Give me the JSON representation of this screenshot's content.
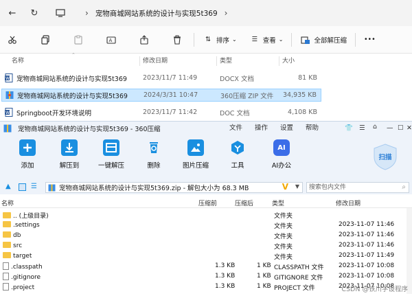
{
  "explorer": {
    "breadcrumb": [
      "宠物商城网站系统的设计与实现5t369"
    ],
    "commands": {
      "sort": "排序",
      "view": "查看",
      "extract_all": "全部解压缩",
      "more": "•••"
    },
    "columns": [
      "名称",
      "修改日期",
      "类型",
      "大小"
    ],
    "files": [
      {
        "name": "宠物商城网站系统的设计与实现5t369",
        "date": "2023/11/7 11:49",
        "type": "DOCX 文档",
        "size": "81 KB",
        "icon": "word-icon",
        "selected": false
      },
      {
        "name": "宠物商城网站系统的设计与实现5t369",
        "date": "2024/3/31 10:47",
        "type": "360压缩 ZIP 文件",
        "size": "34,935 KB",
        "icon": "zip-icon",
        "selected": true
      },
      {
        "name": "Springboot开发环境说明",
        "date": "2023/11/7 11:42",
        "type": "DOC 文档",
        "size": "4,108 KB",
        "icon": "word-icon",
        "selected": false
      }
    ]
  },
  "zip_window": {
    "title": "宠物商城网站系统的设计与实现5t369 - 360压缩",
    "menu": [
      "文件",
      "操作",
      "设置",
      "帮助"
    ],
    "tools": [
      "添加",
      "解压到",
      "一键解压",
      "删除",
      "图片压缩",
      "工具",
      "AI办公"
    ],
    "scan_label": "扫描",
    "path_text": "宠物商城网站系统的设计与实现5t369.zip - 解包大小为 68.3 MB",
    "search_placeholder": "搜索包内文件",
    "columns": [
      "名称",
      "压缩前",
      "压缩后",
      "类型",
      "修改日期"
    ],
    "rows": [
      {
        "name": ".. (上级目录)",
        "before": "",
        "after": "",
        "type": "文件夹",
        "date": "",
        "kind": "folder"
      },
      {
        "name": ".settings",
        "before": "",
        "after": "",
        "type": "文件夹",
        "date": "2023-11-07 11:46",
        "kind": "folder"
      },
      {
        "name": "db",
        "before": "",
        "after": "",
        "type": "文件夹",
        "date": "2023-11-07 11:46",
        "kind": "folder"
      },
      {
        "name": "src",
        "before": "",
        "after": "",
        "type": "文件夹",
        "date": "2023-11-07 11:46",
        "kind": "folder"
      },
      {
        "name": "target",
        "before": "",
        "after": "",
        "type": "文件夹",
        "date": "2023-11-07 11:49",
        "kind": "folder"
      },
      {
        "name": ".classpath",
        "before": "1.3 KB",
        "after": "1 KB",
        "type": "CLASSPATH 文件",
        "date": "2023-11-07 10:08",
        "kind": "file"
      },
      {
        "name": ".gitignore",
        "before": "1.3 KB",
        "after": "1 KB",
        "type": "GITIGNORE 文件",
        "date": "2023-11-07 10:08",
        "kind": "file"
      },
      {
        "name": ".project",
        "before": "1.3 KB",
        "after": "1 KB",
        "type": "PROJECT 文件",
        "date": "2023-11-07 10:08",
        "kind": "file"
      }
    ],
    "watermark": "CSDN @铁川学设程序"
  },
  "colors": {
    "selection": "#cce8ff",
    "toolbar_bg": "#eef3fa",
    "tool_blue": "#1a8fe0",
    "folder": "#f6c544"
  }
}
